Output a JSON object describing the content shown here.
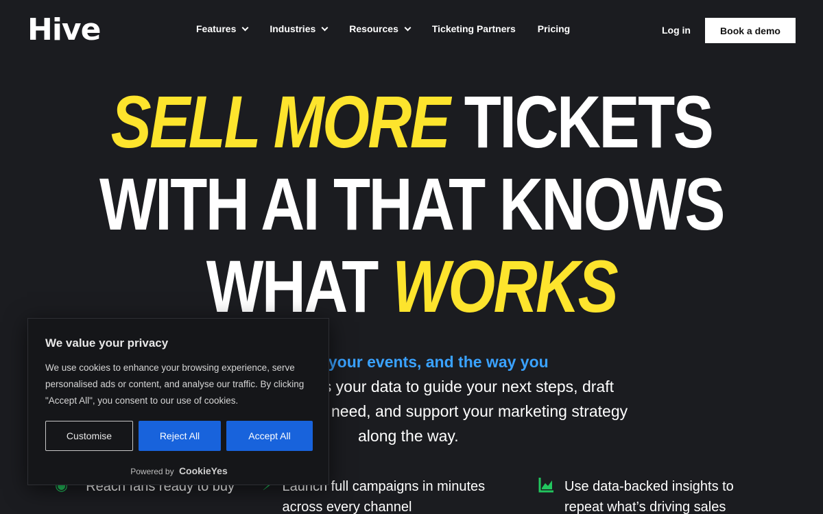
{
  "nav": {
    "logo": "Hive",
    "items": [
      {
        "label": "Features",
        "has_dropdown": true
      },
      {
        "label": "Industries",
        "has_dropdown": true
      },
      {
        "label": "Resources",
        "has_dropdown": true
      },
      {
        "label": "Ticketing Partners",
        "has_dropdown": false
      },
      {
        "label": "Pricing",
        "has_dropdown": false
      }
    ],
    "login": "Log in",
    "demo": "Book a demo"
  },
  "hero": {
    "line1_yellow": "SELL MORE",
    "line1_white": "TICKETS",
    "line2": "WITH AI THAT KNOWS",
    "line3_white": "WHAT",
    "line3_yellow": "WORKS",
    "sub_blue": "ur audience, your events, and the way you",
    "sub_line2": "es your data to guide your next steps, draft",
    "sub_line3": "need, and support your marketing strategy",
    "sub_line4": "along the way."
  },
  "features": [
    {
      "icon": "target-icon",
      "text": "Reach fans ready to buy"
    },
    {
      "icon": "bolt-icon",
      "line1": "Launch full campaigns in minutes",
      "line2": "across every channel"
    },
    {
      "icon": "chart-icon",
      "line1": "Use data-backed insights to",
      "line2": "repeat what’s driving sales"
    }
  ],
  "cookie": {
    "title": "We value your privacy",
    "body": "We use cookies to enhance your browsing experience, serve personalised ads or content, and analyse our traffic. By clicking \"Accept All\", you consent to our use of cookies.",
    "customise": "Customise",
    "reject": "Reject All",
    "accept": "Accept All",
    "powered_by": "Powered by",
    "brand": "CookieYes"
  },
  "colors": {
    "accent_yellow": "#fde42d",
    "accent_blue": "#3aa2ff",
    "button_blue": "#1863dc",
    "background": "#1b1c20"
  }
}
